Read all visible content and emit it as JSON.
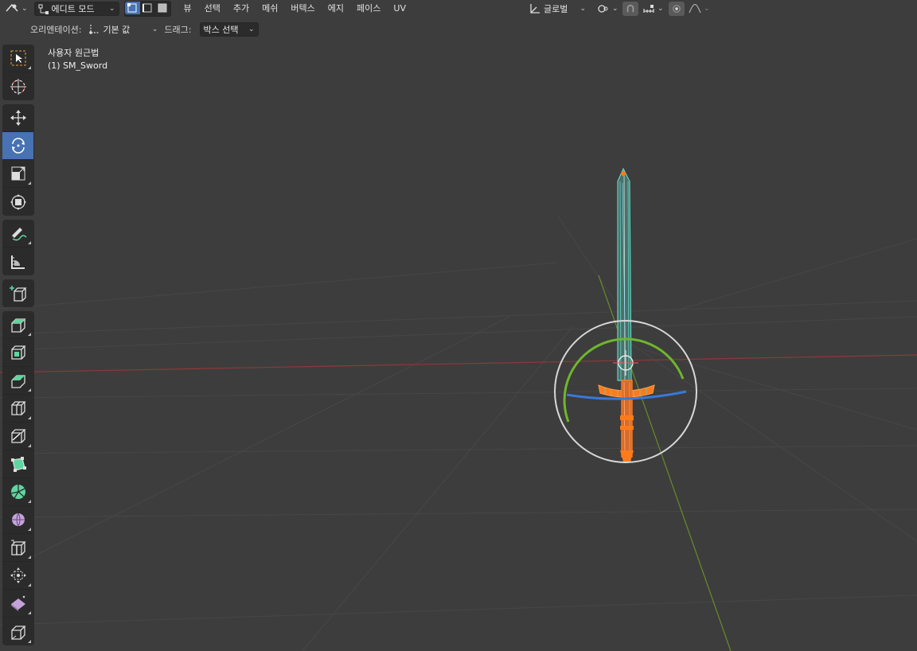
{
  "header": {
    "editor_icon": "editor-type-icon",
    "mode_label": "에디트 모드",
    "menus": [
      "뷰",
      "선택",
      "추가",
      "메쉬",
      "버텍스",
      "에지",
      "페이스",
      "UV"
    ],
    "transform_label": "글로벌"
  },
  "header2": {
    "orientation_label": "오리엔테이션:",
    "orientation_value": "기본 값",
    "drag_label": "드래그:",
    "drag_value": "박스 선택"
  },
  "overlay": {
    "view_name": "사용자 원근법",
    "object_name": "(1) SM_Sword"
  },
  "colors": {
    "accent": "#4772b3",
    "panel": "#2b2b2b",
    "viewport": "#3d3d3d",
    "edge_selected": "#ff7a1a",
    "mesh_wire": "#5ed6c0",
    "gizmo_green": "#6fb62c",
    "gizmo_blue": "#3a78d8",
    "axis_red": "#9c3a3a"
  }
}
